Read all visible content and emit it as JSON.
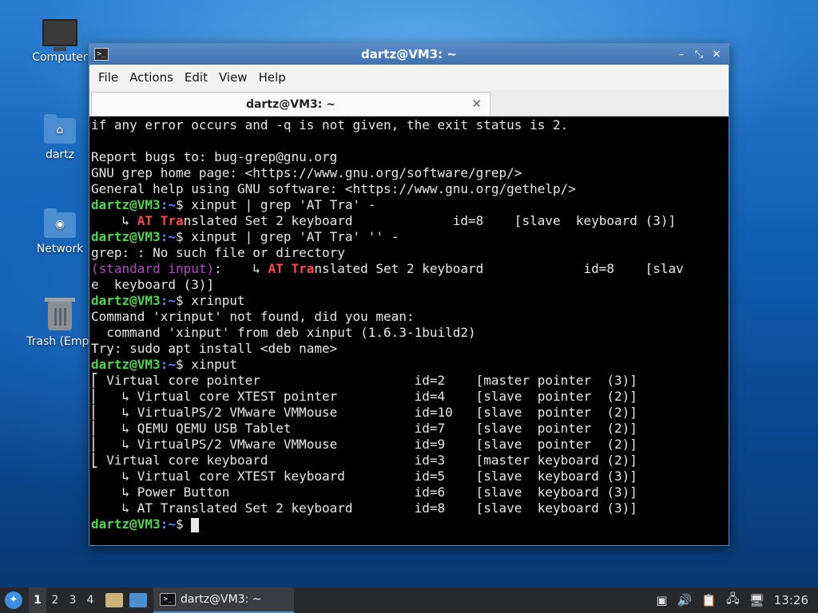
{
  "desktop": {
    "icons": [
      {
        "label": "Computer",
        "icon": "computer-icon"
      },
      {
        "label": "dartz",
        "icon": "home-folder-icon"
      },
      {
        "label": "Network",
        "icon": "network-folder-icon"
      },
      {
        "label": "Trash (Empt",
        "icon": "trash-icon"
      }
    ]
  },
  "window": {
    "title": "dartz@VM3: ~",
    "menu": [
      "File",
      "Actions",
      "Edit",
      "View",
      "Help"
    ],
    "tab_label": "dartz@VM3: ~"
  },
  "terminal": {
    "prompt_user": "dartz@VM3",
    "prompt_dir": ":~",
    "prompt_sym": "$ ",
    "lines": [
      {
        "t": "if any error occurs and -q is not given, the exit status is 2."
      },
      {
        "t": ""
      },
      {
        "t": "Report bugs to: bug-grep@gnu.org"
      },
      {
        "t": "GNU grep home page: <https://www.gnu.org/software/grep/>"
      },
      {
        "t": "General help using GNU software: <https://www.gnu.org/gethelp/>"
      },
      {
        "cmd": "xinput | grep 'AT Tra' -"
      },
      {
        "t1": "    ↳ ",
        "h": "AT Tra",
        "t2": "nslated Set 2 keyboard             id=8    [slave  keyboard (3)]"
      },
      {
        "cmd": "xinput | grep 'AT Tra' '' -"
      },
      {
        "t": "grep: : No such file or directory"
      },
      {
        "m": "(standard input)",
        "t1": ":    ↳ ",
        "h": "AT Tra",
        "t2": "nslated Set 2 keyboard             id=8    [slav"
      },
      {
        "t": "e  keyboard (3)]"
      },
      {
        "cmd": "xrinput"
      },
      {
        "t": "Command 'xrinput' not found, did you mean:"
      },
      {
        "t": "  command 'xinput' from deb xinput (1.6.3-1build2)"
      },
      {
        "t": "Try: sudo apt install <deb name>"
      },
      {
        "cmd": "xinput"
      },
      {
        "t": "⎡ Virtual core pointer                    id=2    [master pointer  (3)]"
      },
      {
        "t": "⎜   ↳ Virtual core XTEST pointer          id=4    [slave  pointer  (2)]"
      },
      {
        "t": "⎜   ↳ VirtualPS/2 VMware VMMouse          id=10   [slave  pointer  (2)]"
      },
      {
        "t": "⎜   ↳ QEMU QEMU USB Tablet                id=7    [slave  pointer  (2)]"
      },
      {
        "t": "⎜   ↳ VirtualPS/2 VMware VMMouse          id=9    [slave  pointer  (2)]"
      },
      {
        "t": "⎣ Virtual core keyboard                   id=3    [master keyboard (2)]"
      },
      {
        "t": "    ↳ Virtual core XTEST keyboard         id=5    [slave  keyboard (3)]"
      },
      {
        "t": "    ↳ Power Button                        id=6    [slave  keyboard (3)]"
      },
      {
        "t": "    ↳ AT Translated Set 2 keyboard        id=8    [slave  keyboard (3)]"
      },
      {
        "cmd": "",
        "cursor": true
      }
    ]
  },
  "taskbar": {
    "workspaces": [
      "1",
      "2",
      "3",
      "4"
    ],
    "active_workspace": "1",
    "task_label": "dartz@VM3: ~",
    "clock": "13:26"
  },
  "colors": {
    "prompt_user": "#4fd44f",
    "prompt_dir": "#5c8cff",
    "match_highlight": "#ff4848",
    "filename": "#b04cc2"
  }
}
